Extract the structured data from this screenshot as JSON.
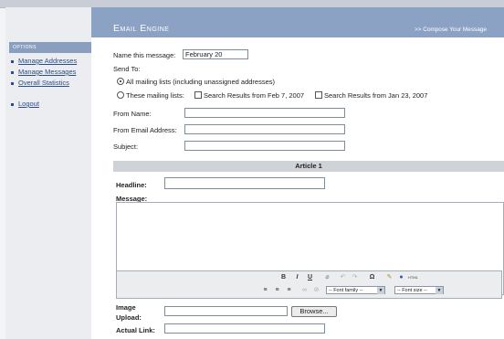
{
  "sidebar": {
    "options_label": "OPTIONS",
    "items": [
      {
        "label": "Manage Addresses"
      },
      {
        "label": "Manage Messages"
      },
      {
        "label": "Overall Statistics"
      },
      {
        "label": "Logout"
      }
    ]
  },
  "header": {
    "title": "Email Engine",
    "compose_link": ">> Compose Your Message"
  },
  "form": {
    "name_label": "Name this message:",
    "name_value": "February 20",
    "send_to_label": "Send To:",
    "radio_all_label": "All mailing lists (including unassigned addresses)",
    "radio_these_label": "These mailing lists:",
    "list_1_label": "Search Results from Feb 7, 2007",
    "list_2_label": "Search Results from Jan 23, 2007",
    "from_name_label": "From Name:",
    "from_email_label": "From Email Address:",
    "subject_label": "Subject:",
    "from_name_value": "",
    "from_email_value": "",
    "subject_value": ""
  },
  "article": {
    "title": "Article 1",
    "headline_label": "Headline:",
    "headline_value": "",
    "message_label": "Message:",
    "image_upload_label_line1": "Image",
    "image_upload_label_line2": "Upload:",
    "browse_label": "Browse...",
    "actual_link_label": "Actual Link:",
    "actual_link_value": ""
  },
  "editor": {
    "bold": "B",
    "italic": "I",
    "underline": "U",
    "special_char": "Ω",
    "font_family": "-- Font family --",
    "font_size": "-- Font size --"
  },
  "colors": {
    "header_bg": "#8ca2c4",
    "link": "#2a4d8a",
    "article_bar": "#cfd2d6"
  }
}
